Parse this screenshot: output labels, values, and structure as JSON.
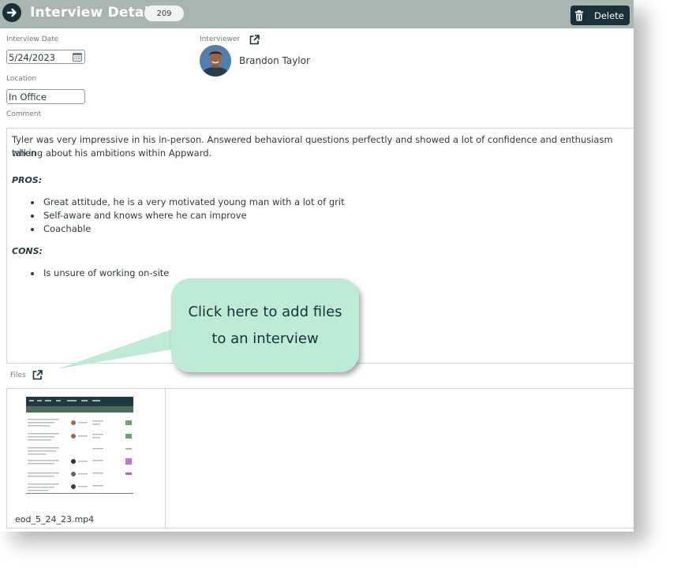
{
  "header": {
    "title": "Interview Details",
    "count": "209",
    "delete_label": "Delete"
  },
  "interview_date": {
    "label": "Interview Date",
    "value": "5/24/2023"
  },
  "interviewer": {
    "label": "Interviewer",
    "name": "Brandon Taylor"
  },
  "location": {
    "label": "Location",
    "value": "In Office"
  },
  "comment": {
    "label": "Comment",
    "intro_line1": "Tyler was very impressive in his in-person. Answered behavioral questions perfectly and showed a lot of confidence and enthusiasm when",
    "intro_line2": "talking about his ambitions within Appward.",
    "pros_heading": "PROS:",
    "pros": [
      "Great attitude, he is a very motivated young man with a lot of grit",
      "Self-aware and knows where he can improve",
      "Coachable"
    ],
    "cons_heading": "CONS:",
    "cons": [
      "Is unsure of working on-site"
    ]
  },
  "files": {
    "label": "Files",
    "items": [
      {
        "name": "eod_5_24_23.mp4"
      }
    ]
  },
  "callout": {
    "line1": "Click here to add files",
    "line2": "to an interview"
  },
  "colors": {
    "header_bg": "#a9b5b0",
    "dark_accent": "#173039",
    "callout_bg": "#bdebd6"
  }
}
